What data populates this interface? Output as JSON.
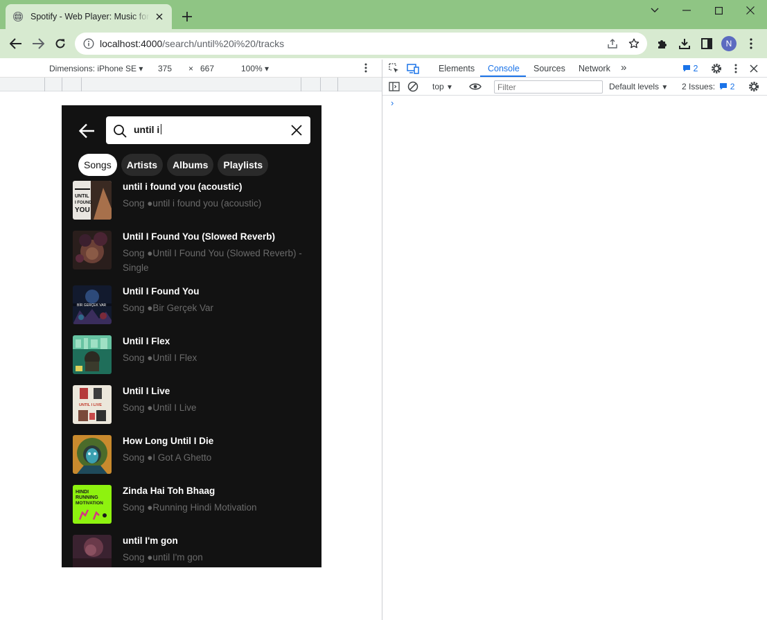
{
  "browser": {
    "tab_title": "Spotify - Web Player: Music for everyone",
    "url_host": "localhost:4000",
    "url_path": "/search/until%20i%20/tracks",
    "profile_initial": "N"
  },
  "device_toolbar": {
    "dimensions_label": "Dimensions: iPhone SE",
    "width": "375",
    "times": "×",
    "height": "667",
    "zoom": "100%"
  },
  "app": {
    "search_value": "until i",
    "chips": [
      "Songs",
      "Artists",
      "Albums",
      "Playlists"
    ],
    "active_chip": "Songs",
    "tracks": [
      {
        "title": "until i found you (acoustic)",
        "subtitle": "Song ●until i found you (acoustic)"
      },
      {
        "title": "Until I Found You (Slowed Reverb)",
        "subtitle": "Song ●Until I Found You (Slowed Reverb) - Single"
      },
      {
        "title": "Until I Found You",
        "subtitle": "Song ●Bir Gerçek Var"
      },
      {
        "title": "Until I Flex",
        "subtitle": "Song ●Until I Flex"
      },
      {
        "title": "Until I Live",
        "subtitle": "Song ●Until I Live"
      },
      {
        "title": "How Long Until I Die",
        "subtitle": "Song ●I Got A Ghetto"
      },
      {
        "title": "Zinda Hai Toh Bhaag",
        "subtitle": "Song ●Running Hindi Motivation"
      },
      {
        "title": "until I'm gon",
        "subtitle": "Song ●until I'm gon"
      }
    ],
    "art_text": {
      "track1": "UNTIL I FOUND YOU",
      "track3": "BİR GERÇEK VAR",
      "track5": "UNTIL I LIVE",
      "track7": "HINDI RUNNING MOTIVATION"
    }
  },
  "devtools": {
    "tabs": [
      "Elements",
      "Console",
      "Sources",
      "Network"
    ],
    "active_tab": "Console",
    "more_tabs": "»",
    "issue_badge_count": "2",
    "context": "top",
    "filter_placeholder": "Filter",
    "levels": "Default levels",
    "issues_label": "2 Issues:",
    "issues_count": "2",
    "prompt_symbol": "›"
  },
  "colors": {
    "chrome_frame": "#8fc584",
    "chrome_toolbar": "#d7ead0",
    "app_bg": "#121212",
    "chip_bg": "#2a2a2a",
    "subtitle": "#6a6a6a",
    "devtools_accent": "#1a73e8"
  }
}
